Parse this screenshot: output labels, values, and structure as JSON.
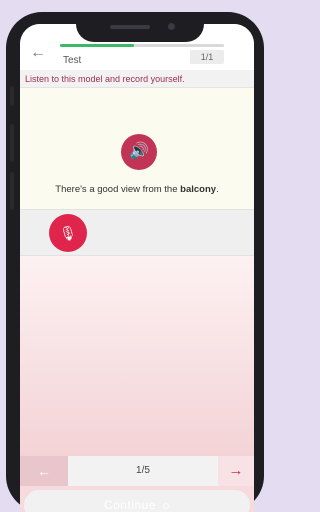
{
  "header": {
    "back_icon": "←",
    "title": "Test",
    "counter": "1/1",
    "progress": 0.45
  },
  "instruction": "Listen to this model and record yourself.",
  "model": {
    "sentence_before": "There's a good view from the ",
    "sentence_bold": "balcony",
    "sentence_after": ".",
    "speaker_icon": "🔊"
  },
  "record": {
    "mic_icon": "🎙"
  },
  "pager": {
    "prev_icon": "←",
    "label": "1/5",
    "next_icon": "→"
  },
  "footer": {
    "continue_label": "Continue",
    "continue_icon": "⊙"
  },
  "colors": {
    "accent": "#c23456",
    "mic": "#e0254c",
    "progress": "#3db868",
    "instruction_text": "#a0304f"
  }
}
